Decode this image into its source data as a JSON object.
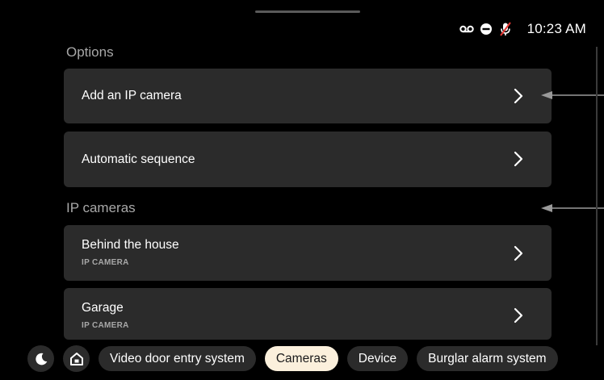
{
  "status_bar": {
    "time": "10:23 AM",
    "icons": [
      "voicemail-icon",
      "do-not-disturb-icon",
      "mic-muted-icon"
    ]
  },
  "sections": {
    "options": {
      "title": "Options",
      "items": [
        {
          "label": "Add an IP camera"
        },
        {
          "label": "Automatic sequence"
        }
      ]
    },
    "ip_cameras": {
      "title": "IP cameras",
      "items": [
        {
          "label": "Behind the house",
          "sub": "IP CAMERA"
        },
        {
          "label": "Garage",
          "sub": "IP CAMERA"
        }
      ]
    }
  },
  "bottom_nav": {
    "night_mode_icon": "moon-icon",
    "home_icon": "home-icon",
    "tabs": [
      {
        "label": "Video door entry system",
        "active": false
      },
      {
        "label": "Cameras",
        "active": true
      },
      {
        "label": "Device",
        "active": false
      },
      {
        "label": "Burglar alarm system",
        "active": false
      }
    ]
  },
  "colors": {
    "background": "#000000",
    "card": "#2b2b2b",
    "secondary_text": "#a8a8a8",
    "active_chip": "#fbf0dc",
    "pointer_arrow": "#9a9a9a",
    "mic_muted_accent": "#e53935"
  }
}
